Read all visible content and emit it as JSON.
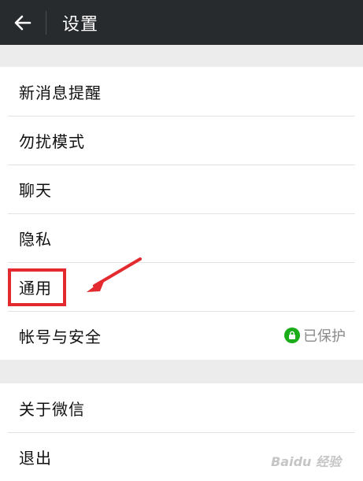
{
  "header": {
    "title": "设置",
    "back_icon": "arrow-left-icon"
  },
  "section1": {
    "items": [
      {
        "label": "新消息提醒"
      },
      {
        "label": "勿扰模式"
      },
      {
        "label": "聊天"
      },
      {
        "label": "隐私"
      },
      {
        "label": "通用"
      },
      {
        "label": "帐号与安全",
        "status": "已保护",
        "status_icon": "lock-icon"
      }
    ]
  },
  "section2": {
    "items": [
      {
        "label": "关于微信"
      },
      {
        "label": "退出"
      }
    ]
  },
  "watermark": "Baidu 经验",
  "colors": {
    "header_bg": "#272b2e",
    "accent_green": "#1aad19",
    "highlight_red": "#e32a2f",
    "page_bg": "#ececec"
  }
}
